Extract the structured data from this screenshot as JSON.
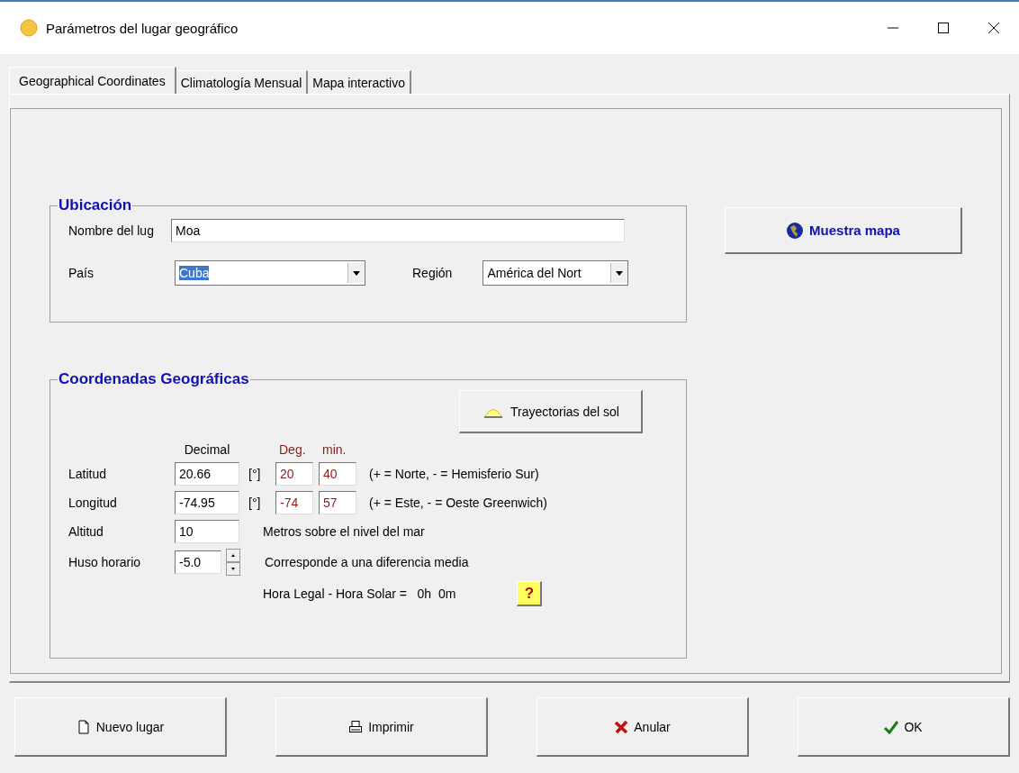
{
  "window": {
    "title": "Parámetros del lugar geográfico"
  },
  "tabs": [
    {
      "label": "Geographical Coordinates",
      "selected": true
    },
    {
      "label": "Climatología Mensual",
      "selected": false
    },
    {
      "label": "Mapa interactivo",
      "selected": false
    }
  ],
  "location": {
    "title": "Ubicación",
    "name_label": "Nombre del lug",
    "name_value": "Moa",
    "country_label": "País",
    "country_value": "Cuba",
    "country_highlighted": true,
    "region_label": "Región",
    "region_value": "América del Nort"
  },
  "map_button": "Muestra mapa",
  "coordinates": {
    "title": "Coordenadas Geográficas",
    "sun_button": "Trayectorias del sol",
    "decimal_header": "Decimal",
    "deg_header": "Deg.",
    "min_header": "min.",
    "rows": [
      {
        "label": "Latitud",
        "decimal": "20.66",
        "unit": "[°]",
        "deg": "20",
        "min": "40",
        "note": "(+ = Norte, - = Hemisferio Sur)"
      },
      {
        "label": "Longitud",
        "decimal": "-74.95",
        "unit": "[°]",
        "deg": "-74",
        "min": "57",
        "note": "(+ = Este, - = Oeste Greenwich)"
      }
    ],
    "altitude": {
      "label": "Altitud",
      "value": "10",
      "note": "Metros sobre el nivel del mar"
    },
    "timezone": {
      "label": "Huso horario",
      "value": "-5.0",
      "note": "Corresponde a una diferencia media"
    },
    "legal_time": "Hora Legal - Hora Solar =   0h  0m",
    "help": "?"
  },
  "buttons": [
    {
      "label": "Nuevo lugar",
      "kind": "new"
    },
    {
      "label": "Imprimir",
      "kind": "print"
    },
    {
      "label": "Anular",
      "kind": "cancel"
    },
    {
      "label": "OK",
      "kind": "ok"
    }
  ]
}
